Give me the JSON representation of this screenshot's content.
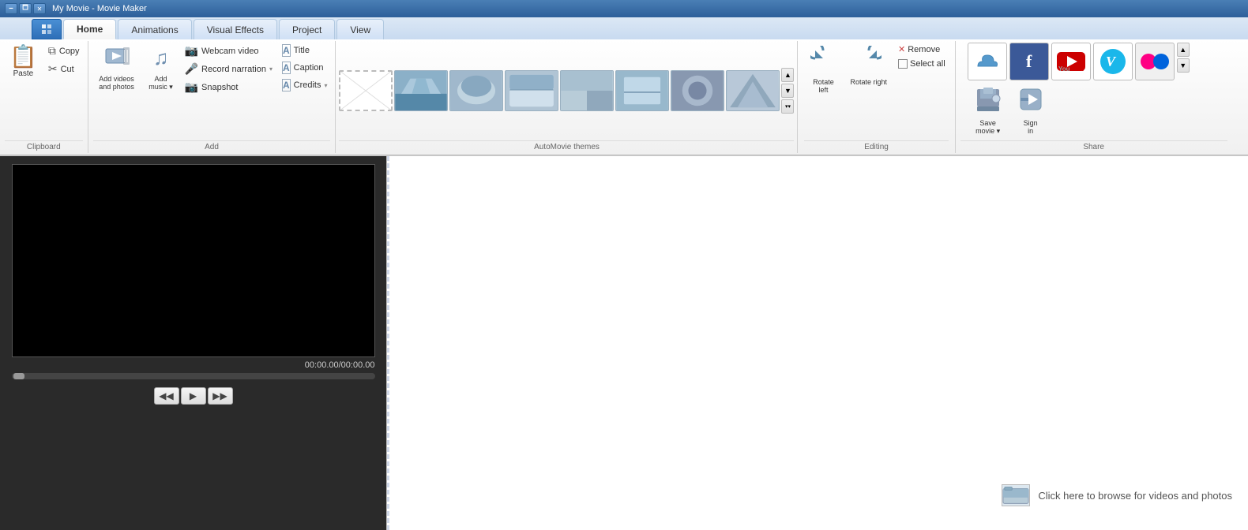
{
  "titleBar": {
    "title": "My Movie - Movie Maker",
    "controls": [
      "🗕",
      "🗖",
      "✕"
    ]
  },
  "tabs": [
    {
      "id": "home",
      "label": "Home",
      "active": true
    },
    {
      "id": "animations",
      "label": "Animations",
      "active": false
    },
    {
      "id": "visualeffects",
      "label": "Visual Effects",
      "active": false
    },
    {
      "id": "project",
      "label": "Project",
      "active": false
    },
    {
      "id": "view",
      "label": "View",
      "active": false
    }
  ],
  "ribbon": {
    "groups": {
      "clipboard": {
        "label": "Clipboard",
        "paste": "Paste",
        "copy": "Copy",
        "cut": "Cut"
      },
      "add": {
        "label": "Add",
        "addVideos": "Add videos\nand photos",
        "addMusic": "Add\nmusic",
        "webcamVideo": "Webcam video",
        "recordNarration": "Record narration",
        "snapshot": "Snapshot",
        "title": "Title",
        "caption": "Caption",
        "credits": "Credits"
      },
      "automovie": {
        "label": "AutoMovie themes",
        "themes": 8
      },
      "editing": {
        "label": "Editing",
        "rotateLeft": "Rotate\nleft",
        "rotateRight": "Rotate\nright",
        "remove": "Remove",
        "selectAll": "Select all"
      },
      "share": {
        "label": "Share",
        "cloud": "☁",
        "facebook": "f",
        "youtube": "▶",
        "vimeo": "V",
        "flickr": "●●",
        "saveMovie": "Save\nmovie",
        "signIn": "Sign\nin"
      }
    }
  },
  "preview": {
    "timeDisplay": "00:00.00/00:00.00",
    "controls": {
      "rewind": "◀◀",
      "play": "▶",
      "forward": "▶▶"
    }
  },
  "storyboard": {
    "hint": "Click here to browse for videos and photos"
  }
}
